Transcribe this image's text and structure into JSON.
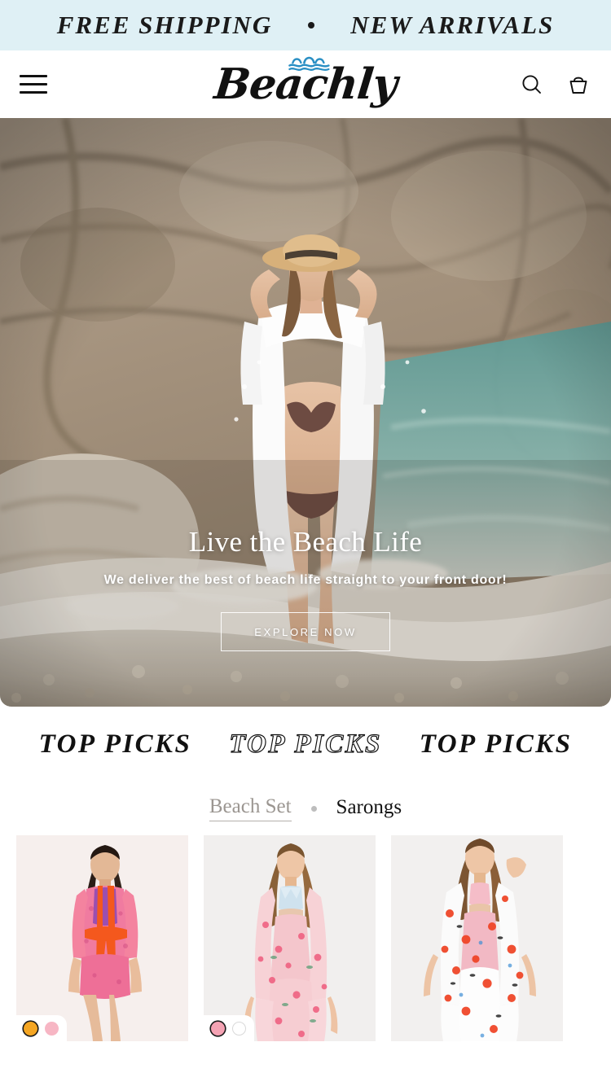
{
  "announcement": {
    "items": [
      "FREE SHIPPING",
      "NEW ARRIVALS"
    ],
    "separator_icon": "bullet-dot-icon",
    "background_color": "#dff0f5",
    "text_color": "#1a1a1a"
  },
  "header": {
    "menu_icon": "hamburger-menu-icon",
    "logo_text": "Beachly",
    "logo_wave_icon": "wave-icon",
    "logo_wave_color": "#2a8fc4",
    "search_icon": "search-icon",
    "cart_icon": "shopping-basket-icon"
  },
  "hero": {
    "title": "Live the Beach Life",
    "subtitle": "We deliver the best of beach life straight to your front door!",
    "cta_label": "EXPLORE NOW",
    "image_alt": "Woman in white cover-up and bikini standing in shallow water beside coastal rocks"
  },
  "marquee": {
    "items": [
      {
        "text": "TOP PICKS",
        "style": "solid"
      },
      {
        "text": "TOP PICKS",
        "style": "outline"
      },
      {
        "text": "TOP PICKS",
        "style": "solid"
      }
    ]
  },
  "tabs": {
    "separator_icon": "dot-separator-icon",
    "items": [
      {
        "label": "Beach Set",
        "active": true
      },
      {
        "label": "Sarongs",
        "active": false
      }
    ]
  },
  "products": [
    {
      "image_alt": "Model wearing pink and orange printed sheer beach cover-up set",
      "bg": "#f5eeec",
      "swatches": [
        {
          "name": "orange",
          "color": "#f5a623",
          "selected": true
        },
        {
          "name": "pink",
          "color": "#f7b6c4",
          "selected": false
        }
      ]
    },
    {
      "image_alt": "Model wearing blush floral kimono and pants beach set with light blue bikini top",
      "bg": "#f0edec",
      "swatches": [
        {
          "name": "pink",
          "color": "#f5a3b4",
          "selected": true
        },
        {
          "name": "white",
          "color": "#ffffff",
          "selected": false
        }
      ]
    },
    {
      "image_alt": "Model wearing white and red floral kimono beach set with pink bikini top",
      "bg": "#f1efee",
      "swatches": []
    }
  ]
}
